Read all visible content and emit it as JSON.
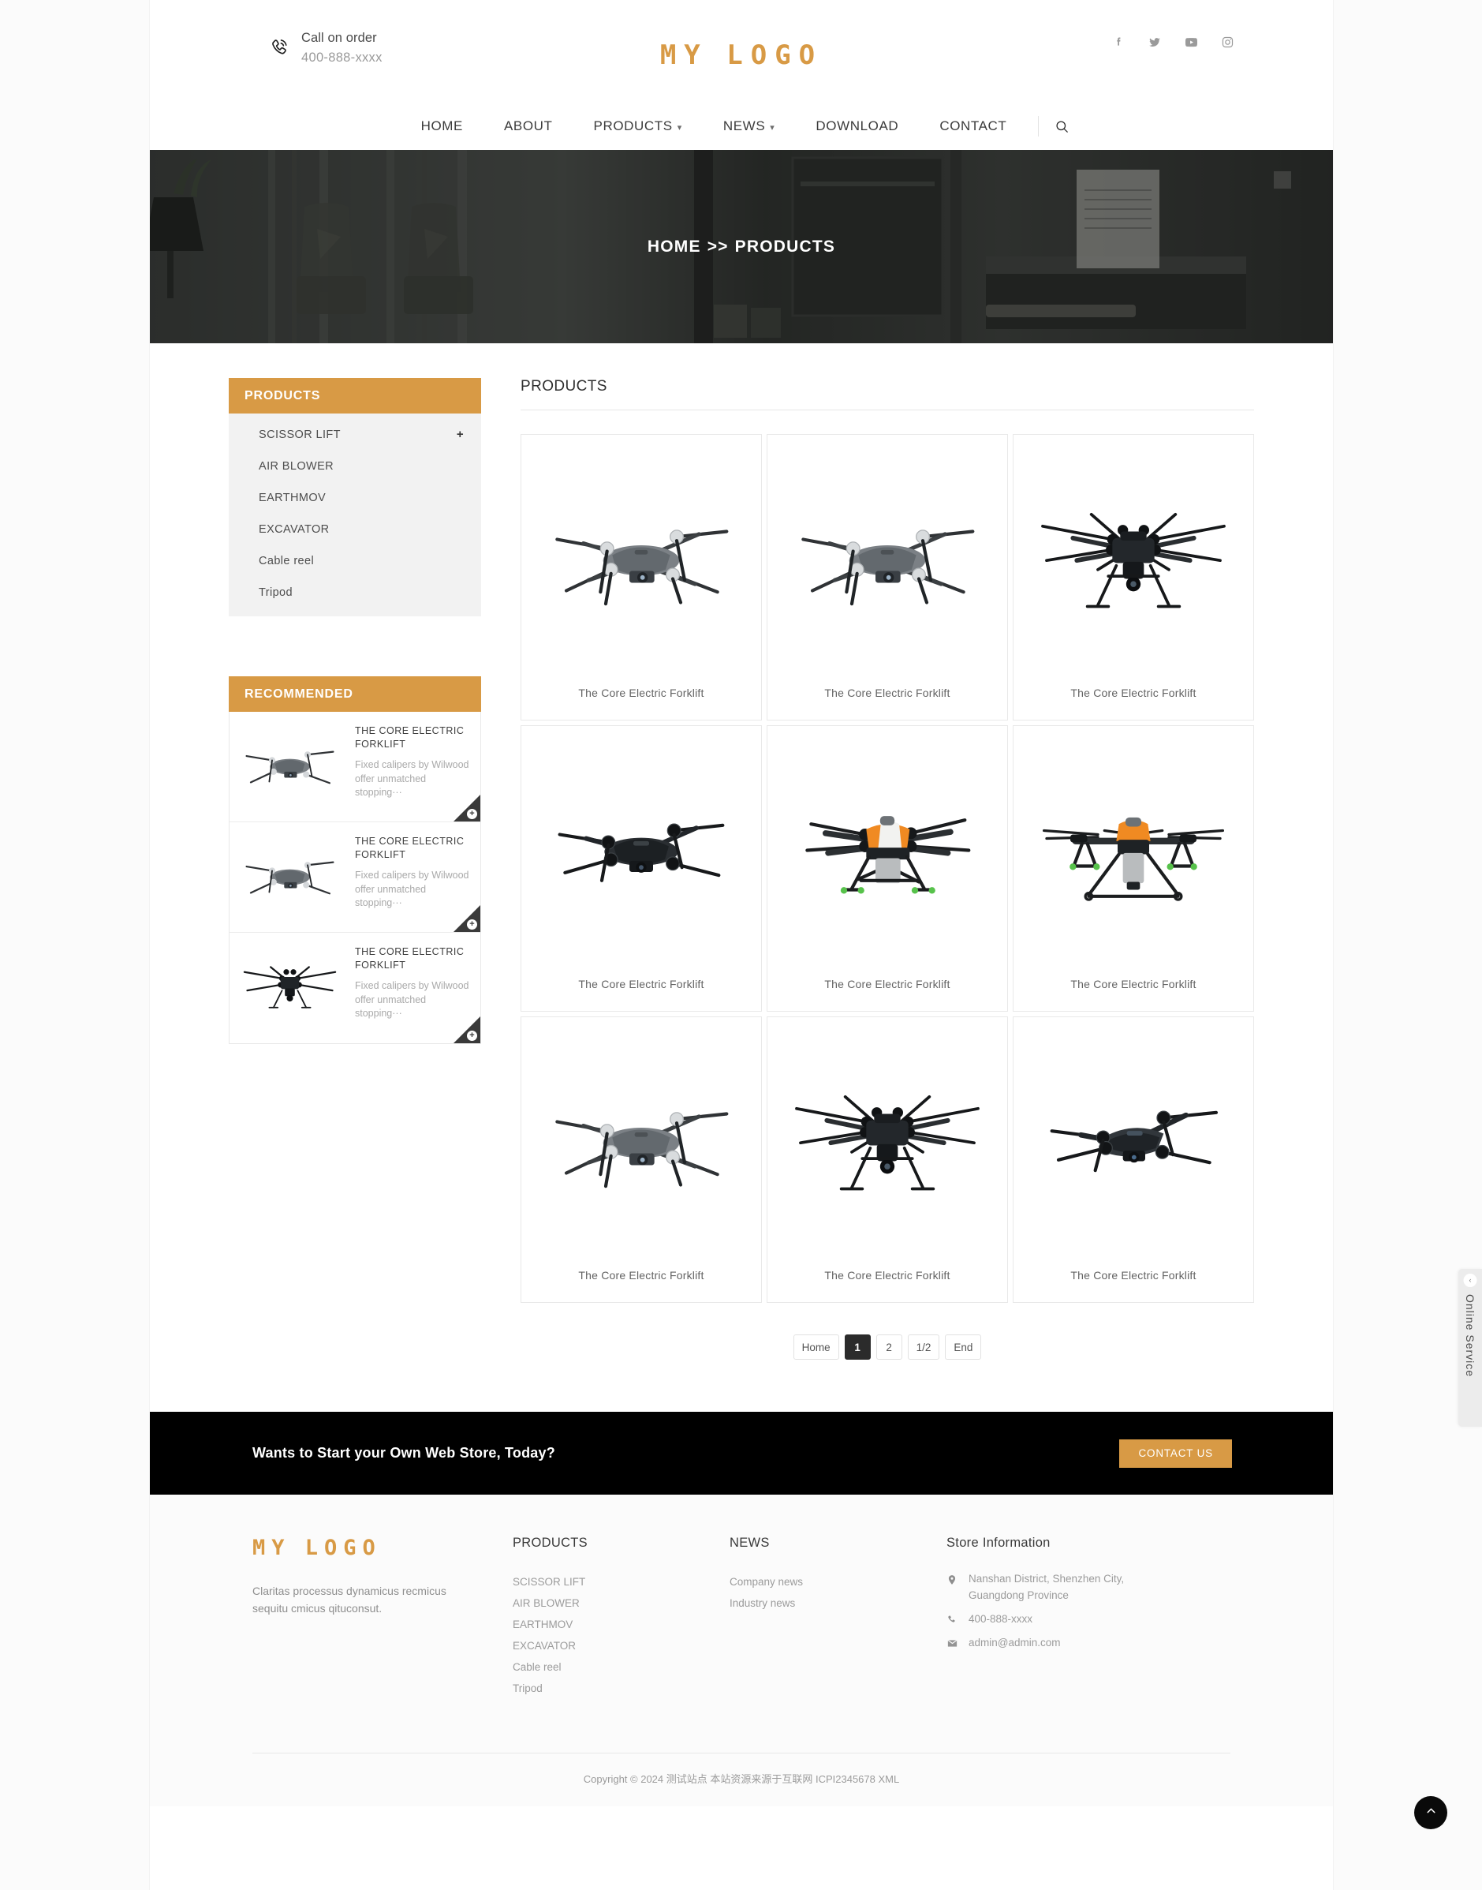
{
  "header": {
    "call_label": "Call on order",
    "call_number": "400-888-xxxx",
    "phone_icon": "phone-icon",
    "logo_part1": "MY",
    "logo_part2": "LOGO",
    "socials": [
      {
        "name": "facebook-icon",
        "label": "f"
      },
      {
        "name": "twitter-icon",
        "label": "t"
      },
      {
        "name": "youtube-icon",
        "label": "y"
      },
      {
        "name": "instagram-icon",
        "label": "i"
      }
    ]
  },
  "nav": {
    "items": [
      {
        "label": "HOME",
        "has_dropdown": false
      },
      {
        "label": "ABOUT",
        "has_dropdown": false
      },
      {
        "label": "PRODUCTS",
        "has_dropdown": true
      },
      {
        "label": "NEWS",
        "has_dropdown": true
      },
      {
        "label": "DOWNLOAD",
        "has_dropdown": false
      },
      {
        "label": "CONTACT",
        "has_dropdown": false
      }
    ],
    "search_icon": "search-icon"
  },
  "banner": {
    "crumb_home": "HOME",
    "crumb_sep": ">>",
    "crumb_current": "PRODUCTS"
  },
  "sidebar": {
    "products_panel": {
      "title": "PRODUCTS",
      "items": [
        {
          "label": "SCISSOR LIFT",
          "expandable": "+"
        },
        {
          "label": "AIR BLOWER",
          "expandable": ""
        },
        {
          "label": "EARTHMOV",
          "expandable": ""
        },
        {
          "label": "EXCAVATOR",
          "expandable": ""
        },
        {
          "label": "Cable reel",
          "expandable": ""
        },
        {
          "label": "Tripod",
          "expandable": ""
        }
      ]
    },
    "recommended_panel": {
      "title": "RECOMMENDED",
      "items": [
        {
          "title": "THE CORE ELECTRIC FORKLIFT",
          "desc": "Fixed calipers by Wilwood offer unmatched stopping···",
          "thumb": "drone-gray-quad"
        },
        {
          "title": "THE CORE ELECTRIC FORKLIFT",
          "desc": "Fixed calipers by Wilwood offer unmatched stopping···",
          "thumb": "drone-gray-quad"
        },
        {
          "title": "THE CORE ELECTRIC FORKLIFT",
          "desc": "Fixed calipers by Wilwood offer unmatched stopping···",
          "thumb": "drone-black-hexa"
        }
      ]
    }
  },
  "main": {
    "title": "PRODUCTS",
    "products": [
      {
        "caption": "The Core Electric Forklift",
        "image": "drone-gray-quad"
      },
      {
        "caption": "The Core Electric Forklift",
        "image": "drone-gray-quad"
      },
      {
        "caption": "The Core Electric Forklift",
        "image": "drone-black-hexa"
      },
      {
        "caption": "The Core Electric Forklift",
        "image": "drone-black-folded"
      },
      {
        "caption": "The Core Electric Forklift",
        "image": "drone-orange-agri"
      },
      {
        "caption": "The Core Electric Forklift",
        "image": "drone-orange-agri-front"
      },
      {
        "caption": "The Core Electric Forklift",
        "image": "drone-gray-quad"
      },
      {
        "caption": "The Core Electric Forklift",
        "image": "drone-black-hexa"
      },
      {
        "caption": "The Core Electric Forklift",
        "image": "drone-black-folded"
      }
    ],
    "pagination": [
      {
        "label": "Home",
        "active": false
      },
      {
        "label": "1",
        "active": true
      },
      {
        "label": "2",
        "active": false
      },
      {
        "label": "1/2",
        "active": false
      },
      {
        "label": "End",
        "active": false
      }
    ]
  },
  "cta": {
    "text": "Wants to Start your Own Web Store, Today?",
    "button": "CONTACT US"
  },
  "footer": {
    "logo_part1": "MY",
    "logo_part2": "LOGO",
    "description": "Claritas processus dynamicus recmicus sequitu cmicus qituconsut.",
    "products": {
      "heading": "PRODUCTS",
      "links": [
        "SCISSOR LIFT",
        "AIR BLOWER",
        "EARTHMOV",
        "EXCAVATOR",
        "Cable reel",
        "Tripod"
      ]
    },
    "news": {
      "heading": "NEWS",
      "links": [
        "Company news",
        "Industry news"
      ]
    },
    "store": {
      "heading": "Store Information",
      "address": "Nanshan District, Shenzhen City, Guangdong Province",
      "phone": "400-888-xxxx",
      "email": "admin@admin.com",
      "address_icon": "location-pin-icon",
      "phone_icon": "phone-icon",
      "email_icon": "envelope-icon"
    },
    "copyright": "Copyright © 2024 测试站点 本站资源来源于互联网 ICPI2345678 XML"
  },
  "widgets": {
    "online_service_label": "Online Service",
    "online_service_toggle": "‹",
    "back_to_top_icon": "chevron-up-icon"
  },
  "colors": {
    "accent": "#d89a45",
    "dark": "#000000",
    "panel_bg": "#f2f2f2"
  }
}
